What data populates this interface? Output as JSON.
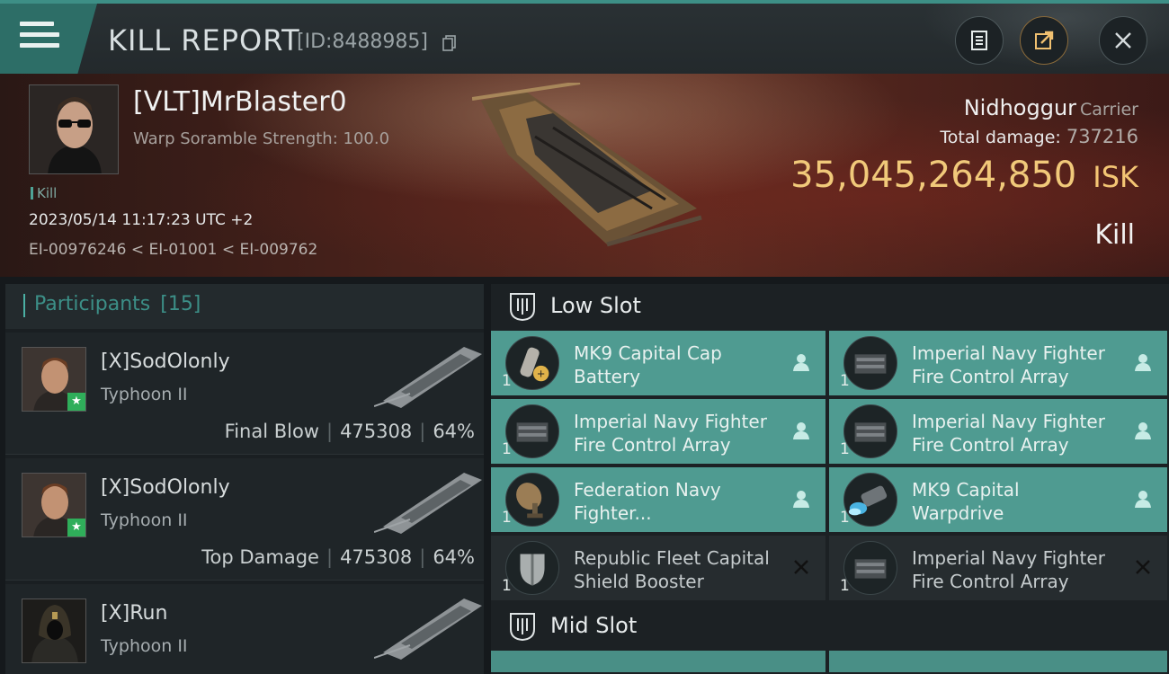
{
  "header": {
    "title": "KILL REPORT",
    "report_id": "[ID:8488985]"
  },
  "victim": {
    "name": "[VLT]MrBlaster0",
    "warp_scramble": "Warp Soramble Strength: 100.0",
    "tag": "Kill",
    "datetime": "2023/05/14 11:17:23 UTC +2",
    "systems": "EI-00976246 < EI-01001 < EI-009762",
    "ship_name": "Nidhoggur",
    "ship_class": "Carrier",
    "damage_label": "Total damage:",
    "damage_value": "737216",
    "isk_value": "35,045,264,850",
    "isk_unit": "ISK",
    "result": "Kill"
  },
  "participants": {
    "label": "Participants",
    "count": "[15]",
    "rows": [
      {
        "name": "[X]SodOlonly",
        "ship": "Typhoon II",
        "role": "Final Blow",
        "damage": "475308",
        "percent": "64%"
      },
      {
        "name": "[X]SodOlonly",
        "ship": "Typhoon II",
        "role": "Top Damage",
        "damage": "475308",
        "percent": "64%"
      },
      {
        "name": "[X]Run",
        "ship": "Typhoon II",
        "role": "",
        "damage": "",
        "percent": ""
      }
    ]
  },
  "fitting": {
    "low_slot_label": "Low Slot",
    "mid_slot_label": "Mid Slot",
    "low_items": [
      {
        "qty": "1",
        "line1": "MK9 Capital Cap",
        "line2": "Battery",
        "icon": "cap-battery-icon",
        "status": "dropped"
      },
      {
        "qty": "1",
        "line1": "Imperial Navy Fighter",
        "line2": "Fire Control Array",
        "icon": "fighter-fca-icon",
        "status": "dropped"
      },
      {
        "qty": "1",
        "line1": "Imperial Navy Fighter",
        "line2": "Fire Control Array",
        "icon": "fighter-fca-icon",
        "status": "dropped"
      },
      {
        "qty": "1",
        "line1": "Imperial Navy Fighter",
        "line2": "Fire Control Array",
        "icon": "fighter-fca-icon",
        "status": "dropped"
      },
      {
        "qty": "1",
        "line1": "Federation Navy",
        "line2": "Fighter...",
        "icon": "dish-icon",
        "status": "dropped"
      },
      {
        "qty": "1",
        "line1": "MK9 Capital",
        "line2": "Warpdrive",
        "icon": "warpdrive-icon",
        "status": "dropped"
      },
      {
        "qty": "1",
        "line1": "Republic Fleet Capital",
        "line2": "Shield Booster",
        "icon": "shield-booster-icon",
        "status": "destroyed"
      },
      {
        "qty": "1",
        "line1": "Imperial Navy Fighter",
        "line2": "Fire Control Array",
        "icon": "fighter-fca-icon",
        "status": "destroyed"
      }
    ]
  },
  "colors": {
    "accent": "#4f9b91",
    "isk": "#f1c97a",
    "banner": "#4a221b"
  }
}
